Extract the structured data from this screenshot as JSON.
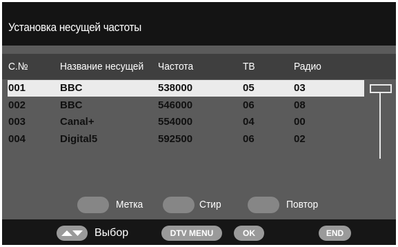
{
  "title": "Установка несущей частоты",
  "columns": {
    "num": "С.№",
    "name": "Название несущей",
    "freq": "Частота",
    "tv": "ТВ",
    "radio": "Радио"
  },
  "rows": [
    {
      "num": "001",
      "name": "BBC",
      "freq": "538000",
      "tv": "05",
      "radio": "03"
    },
    {
      "num": "002",
      "name": "BBC",
      "freq": "546000",
      "tv": "06",
      "radio": "08"
    },
    {
      "num": "003",
      "name": "Canal+",
      "freq": "554000",
      "tv": "04",
      "radio": "00"
    },
    {
      "num": "004",
      "name": "Digital5",
      "freq": "592500",
      "tv": "06",
      "radio": "02"
    }
  ],
  "color_buttons": {
    "mark": "Метка",
    "delete": "Стир",
    "repeat": "Повтор"
  },
  "footer": {
    "select_label": "Выбор",
    "dtv_menu": "DTV MENU",
    "ok": "OK",
    "end": "END"
  }
}
